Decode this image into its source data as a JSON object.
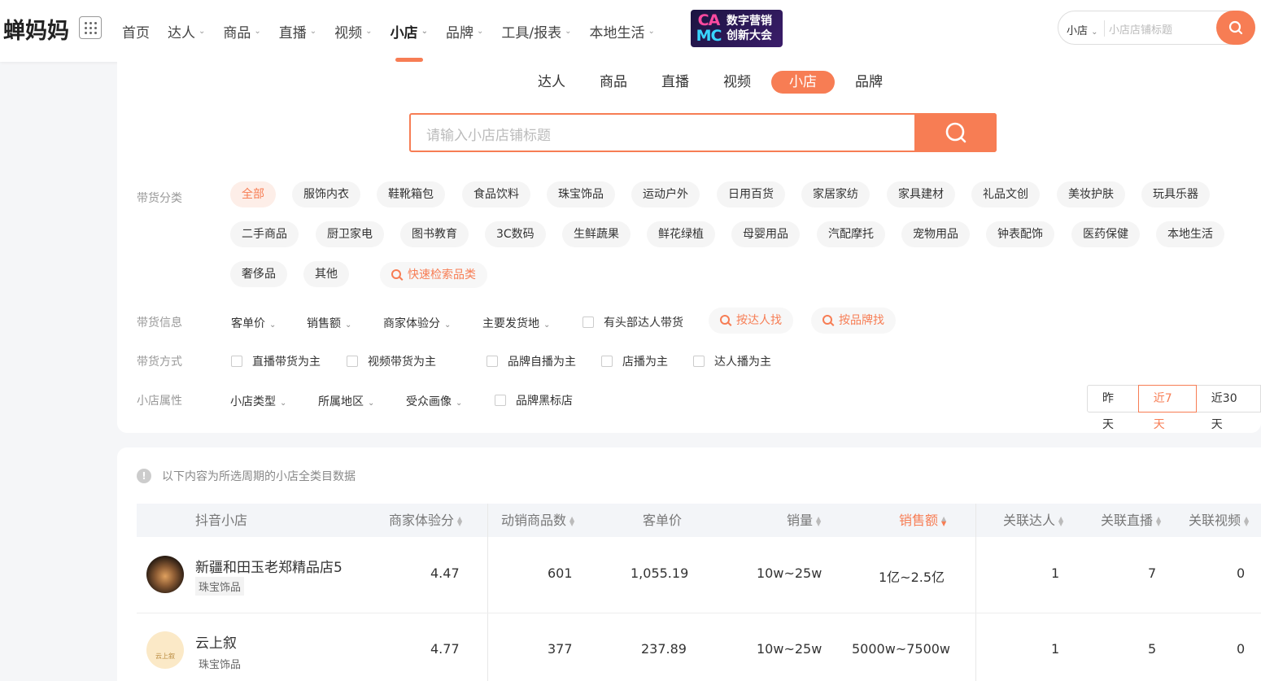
{
  "brand": {
    "logo_text": "蝉妈妈"
  },
  "nav": {
    "items": [
      {
        "label": "首页",
        "dropdown": false
      },
      {
        "label": "达人",
        "dropdown": true
      },
      {
        "label": "商品",
        "dropdown": true
      },
      {
        "label": "直播",
        "dropdown": true
      },
      {
        "label": "视频",
        "dropdown": true
      },
      {
        "label": "小店",
        "dropdown": true,
        "active": true
      },
      {
        "label": "品牌",
        "dropdown": true
      },
      {
        "label": "工具/报表",
        "dropdown": true
      },
      {
        "label": "本地生活",
        "dropdown": true
      }
    ],
    "chevron": "⌄",
    "banner": {
      "logo_line1": "CA",
      "logo_line2": "MC",
      "text_line1": "数字营销",
      "text_line2": "创新大会"
    }
  },
  "top_search": {
    "scope": "小店",
    "placeholder": "小店店铺标题"
  },
  "subtabs": [
    "达人",
    "商品",
    "直播",
    "视频",
    "小店",
    "品牌"
  ],
  "subtab_active": "小店",
  "main_search": {
    "placeholder": "请输入小店店铺标题"
  },
  "filters": {
    "category_label": "带货分类",
    "categories_row1": [
      "全部",
      "服饰内衣",
      "鞋靴箱包",
      "食品饮料",
      "珠宝饰品",
      "运动户外",
      "日用百货",
      "家居家纺",
      "家具建材",
      "礼品文创",
      "美妆护肤",
      "玩具乐器"
    ],
    "categories_row2": [
      "二手商品",
      "厨卫家电",
      "图书教育",
      "3C数码",
      "生鲜蔬果",
      "鲜花绿植",
      "母婴用品",
      "汽配摩托",
      "宠物用品",
      "钟表配饰",
      "医药保健",
      "本地生活"
    ],
    "categories_row3": [
      "奢侈品",
      "其他"
    ],
    "quick_search": "快速检索品类",
    "info_label": "带货信息",
    "info_dropdowns": [
      "客单价",
      "销售额",
      "商家体验分",
      "主要发货地"
    ],
    "info_checkbox": "有头部达人带货",
    "info_buttons": [
      "按达人找",
      "按品牌找"
    ],
    "method_label": "带货方式",
    "methods": [
      "直播带货为主",
      "视频带货为主",
      "品牌自播为主",
      "店播为主",
      "达人播为主"
    ],
    "attr_label": "小店属性",
    "attr_dropdowns": [
      "小店类型",
      "所属地区",
      "受众画像"
    ],
    "attr_checkbox": "品牌黑标店",
    "date_options": [
      "昨天",
      "近7天",
      "近30天"
    ],
    "date_active": "近7天"
  },
  "table": {
    "notice": "以下内容为所选周期的小店全类目数据",
    "notice_icon": "!",
    "columns": [
      "抖音小店",
      "商家体验分",
      "动销商品数",
      "客单价",
      "销量",
      "销售额",
      "关联达人",
      "关联直播",
      "关联视频"
    ],
    "rows": [
      {
        "name": "新疆和田玉老郑精品店5",
        "category": "珠宝饰品",
        "score": "4.47",
        "products": "601",
        "unit_price": "1,055.19",
        "volume": "10w~25w",
        "sales": "1亿~2.5亿",
        "influencers": "1",
        "lives": "7",
        "videos": "0",
        "avatar_colors": [
          "#3b2a1e",
          "#c98b4e"
        ]
      },
      {
        "name": "云上叙",
        "category": "珠宝饰品",
        "score": "4.77",
        "products": "377",
        "unit_price": "237.89",
        "volume": "10w~25w",
        "sales": "5000w~7500w",
        "influencers": "1",
        "lives": "5",
        "videos": "0",
        "avatar_colors": [
          "#fbe9c7",
          "#c9a15b"
        ],
        "avatar_text": "云上叙"
      }
    ]
  },
  "colors": {
    "accent": "#f77d54",
    "bg": "#f5f6f8"
  }
}
